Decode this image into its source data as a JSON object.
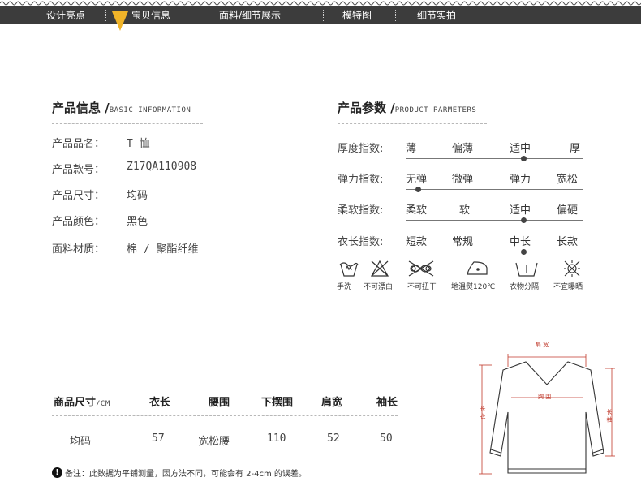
{
  "nav": {
    "items": [
      "设计亮点",
      "宝贝信息",
      "面料/细节展示",
      "模特图",
      "细节实拍"
    ],
    "accent": "#f0b429"
  },
  "product_info": {
    "title": "产品信息 /",
    "subtitle": "BASIC INFORMATION",
    "rows": [
      {
        "label": "产品品名：",
        "value": "T 恤"
      },
      {
        "label": "产品款号：",
        "value": "Z17QA110908"
      },
      {
        "label": "产品尺寸：",
        "value": "均码"
      },
      {
        "label": "产品颜色：",
        "value": "黑色"
      },
      {
        "label": "面料材质：",
        "value": "棉 / 聚酯纤维"
      }
    ]
  },
  "product_params": {
    "title": "产品参数 /",
    "subtitle": "PRODUCT PARMETERS",
    "rows": [
      {
        "label": "厚度指数:",
        "options": [
          "薄",
          "偏薄",
          "适中",
          "厚"
        ],
        "selected": 2
      },
      {
        "label": "弹力指数:",
        "options": [
          "无弹",
          "微弹",
          "弹力",
          "宽松"
        ],
        "selected": 0
      },
      {
        "label": "柔软指数:",
        "options": [
          "柔软",
          "软",
          "适中",
          "偏硬"
        ],
        "selected": 2
      },
      {
        "label": "衣长指数:",
        "options": [
          "短款",
          "常规",
          "中长",
          "长款"
        ],
        "selected": 2
      }
    ],
    "care": [
      {
        "icon": "hand-wash-icon",
        "label": "手洗"
      },
      {
        "icon": "no-bleach-icon",
        "label": "不可漂白"
      },
      {
        "icon": "no-wring-icon",
        "label": "不可扭干"
      },
      {
        "icon": "low-iron-icon",
        "label": "地温熨120℃"
      },
      {
        "icon": "wash-separately-icon",
        "label": "衣物分隔"
      },
      {
        "icon": "no-sun-dry-icon",
        "label": "不宜曝晒"
      }
    ]
  },
  "size_table": {
    "header_main": "商品尺寸",
    "header_unit": "/CM",
    "columns": [
      "衣长",
      "腰围",
      "下摆围",
      "肩宽",
      "袖长"
    ],
    "row": {
      "size": "均码",
      "values": [
        "57",
        "宽松腰",
        "110",
        "52",
        "50"
      ]
    }
  },
  "note": {
    "icon": "!",
    "text": "备注：此数据为平铺测量，因方法不同，可能会有 2-4cm 的误差。"
  },
  "diagram": {
    "labels": {
      "shoulder": "肩 宽",
      "chest": "胸 围",
      "length": "长 衣",
      "sleeve": "长 袖"
    },
    "line_color": "#c0392b"
  }
}
